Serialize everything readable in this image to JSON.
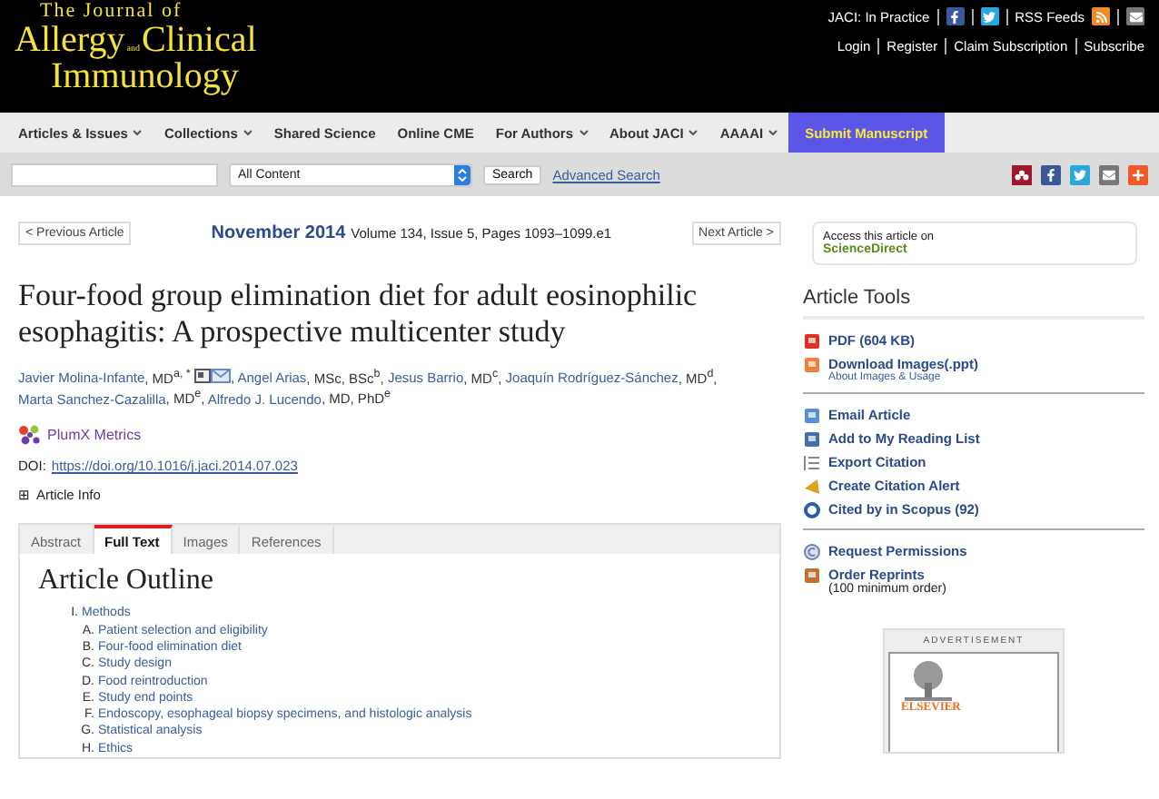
{
  "header": {
    "logo": {
      "line1": "The Journal of",
      "word1": "Allergy",
      "joiner": "and",
      "word2": "Clinical",
      "line3": "Immunology"
    },
    "top_links": [
      {
        "label": "JACI: In Practice",
        "kind": "text"
      },
      {
        "kind": "facebook"
      },
      {
        "kind": "twitter"
      },
      {
        "label": "RSS Feeds",
        "kind": "rss"
      },
      {
        "kind": "mail"
      }
    ],
    "account_links": [
      "Login",
      "Register",
      "Claim Subscription",
      "Subscribe"
    ]
  },
  "nav": [
    {
      "label": "Articles & Issues",
      "dropdown": true,
      "highlight": false
    },
    {
      "label": "Collections",
      "dropdown": true,
      "highlight": false
    },
    {
      "label": "Shared Science",
      "dropdown": false,
      "highlight": false
    },
    {
      "label": "Online CME",
      "dropdown": false,
      "highlight": false
    },
    {
      "label": "For Authors",
      "dropdown": true,
      "highlight": false
    },
    {
      "label": "About JACI",
      "dropdown": true,
      "highlight": false
    },
    {
      "label": "AAAAI",
      "dropdown": true,
      "highlight": false
    },
    {
      "label": "Submit Manuscript",
      "dropdown": false,
      "highlight": true
    }
  ],
  "search": {
    "scope": "All Content",
    "button": "Search",
    "advanced": "Advanced Search",
    "share": [
      {
        "kind": "mendeley"
      },
      {
        "kind": "facebook"
      },
      {
        "kind": "twitter"
      },
      {
        "kind": "mail"
      },
      {
        "kind": "plus"
      }
    ]
  },
  "article": {
    "prev": "< Previous Article",
    "next": "Next Article >",
    "issue_date": "November 2014",
    "issue_info": "Volume 134, Issue 5, Pages 1093–1099.e1",
    "title": "Four-food group elimination diet for adult eosinophilic esophagitis: A prospective multicenter study",
    "authors": [
      {
        "name": "Javier Molina-Infante",
        "degree": ", MD$^{a, *}$",
        "separator": ",",
        "contact": [
          {
            "kind": "card"
          },
          {
            "kind": "mail"
          }
        ]
      },
      {
        "name": "Angel Arias",
        "degree": ", MSc, BSc$^{b}$",
        "separator": ","
      },
      {
        "name": "Jesus Barrio",
        "degree": ", MD$^{c}$",
        "separator": ","
      },
      {
        "name": "Joaquín Rodríguez-Sánchez",
        "degree": ", MD$^{d}$",
        "separator": ","
      },
      {
        "name": "Marta Sanchez-Cazalilla",
        "degree": ", MD$^{e}$",
        "separator": ","
      },
      {
        "name": "Alfredo J. Lucendo",
        "degree": ", MD, PhD$^{e}$"
      }
    ],
    "metrics": "PlumX Metrics",
    "doi_label": "DOI:",
    "doi": "https://doi.org/10.1016/j.jaci.2014.07.023",
    "info_toggle": "⊞",
    "info": "Article Info",
    "tabs": [
      {
        "label": "Abstract",
        "selected": false
      },
      {
        "label": "Full Text",
        "selected": true
      },
      {
        "label": "Images",
        "selected": false
      },
      {
        "label": "References",
        "selected": false
      }
    ],
    "outline_title": "Article Outline",
    "outline": [
      {
        "marker": "I.",
        "label": "Methods",
        "children": [
          {
            "marker": "A.",
            "label": "Patient selection and eligibility"
          },
          {
            "marker": "B.",
            "label": "Four-food elimination diet"
          },
          {
            "marker": "C.",
            "label": "Study design"
          },
          {
            "marker": "D.",
            "label": "Food reintroduction"
          },
          {
            "marker": "E.",
            "label": "Study end points"
          },
          {
            "marker": "F.",
            "label": "Endoscopy, esophageal biopsy specimens, and histologic analysis"
          },
          {
            "marker": "G.",
            "label": "Statistical analysis"
          },
          {
            "marker": "H.",
            "label": "Ethics"
          }
        ]
      }
    ]
  },
  "sidebar": {
    "access_text": "Access this article on",
    "access_link": "ScienceDirect",
    "tools_title": "Article Tools",
    "groups": [
      [
        {
          "kind": "pdf",
          "label": "PDF (604 KB)"
        },
        {
          "kind": "images",
          "label": "Download Images(.ppt)",
          "note": "About Images & Usage"
        }
      ],
      [
        {
          "kind": "email",
          "label": "Email Article"
        },
        {
          "kind": "reading",
          "label": "Add to My Reading List"
        },
        {
          "kind": "export",
          "label": "Export Citation"
        },
        {
          "kind": "alert",
          "label": "Create Citation Alert"
        },
        {
          "kind": "scopus",
          "label": "Cited by in Scopus (92)"
        }
      ],
      [
        {
          "kind": "permissions",
          "label": "Request Permissions"
        },
        {
          "kind": "reprints",
          "label": "Order Reprints",
          "plain": "(100 minimum order)"
        }
      ]
    ],
    "ad_label": "ADVERTISEMENT",
    "ad_logo": "ELSEVIER"
  }
}
